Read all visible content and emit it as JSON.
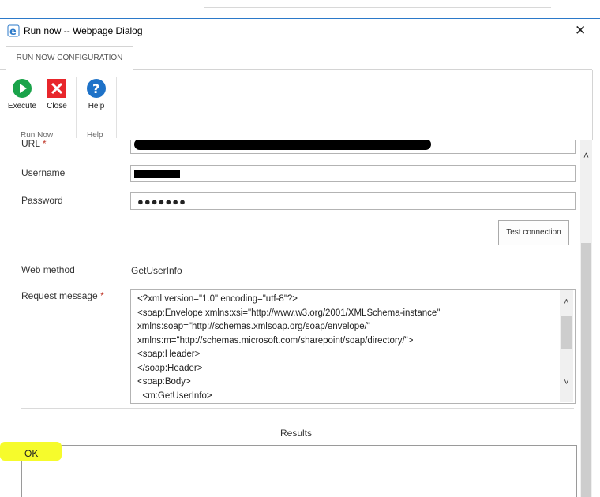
{
  "window": {
    "title": "Run now -- Webpage Dialog",
    "close_glyph": "✕"
  },
  "ribbon": {
    "tab_label": "RUN NOW CONFIGURATION",
    "buttons": [
      {
        "label": "Execute",
        "icon": "play-icon",
        "color": "#1aa34a"
      },
      {
        "label": "Close",
        "icon": "close-x-icon",
        "color": "#e8262b"
      },
      {
        "label": "Help",
        "icon": "help-icon",
        "color": "#1e72c8"
      }
    ],
    "groups": [
      "Run Now",
      "Help"
    ]
  },
  "form": {
    "url_label": "URL",
    "username_label": "Username",
    "password_label": "Password",
    "password_value": "●●●●●●●",
    "required_marker": "*",
    "test_connection_label": "Test connection",
    "web_method_label": "Web method",
    "web_method_value": "GetUserInfo",
    "request_message_label": "Request message",
    "request_message_value": "<?xml version=\"1.0\" encoding=\"utf-8\"?>\n<soap:Envelope xmlns:xsi=\"http://www.w3.org/2001/XMLSchema-instance\"\nxmlns:soap=\"http://schemas.xmlsoap.org/soap/envelope/\"\nxmlns:m=\"http://schemas.microsoft.com/sharepoint/soap/directory/\">\n<soap:Header>\n</soap:Header>\n<soap:Body>\n  <m:GetUserInfo>"
  },
  "results": {
    "title": "Results",
    "value": "OK"
  },
  "colors": {
    "highlight": "#f6fb2c",
    "titlebar_border": "#2b79c9"
  }
}
